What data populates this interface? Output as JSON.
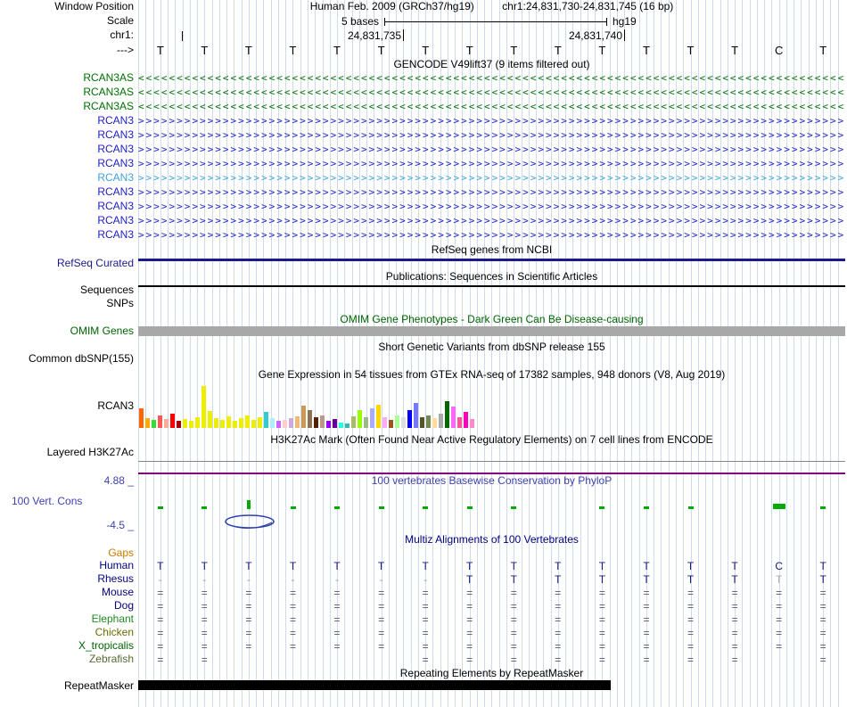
{
  "header": {
    "window_position_label": "Window Position",
    "assembly_text": "Human Feb. 2009 (GRCh37/hg19)",
    "position_text": "chr1:24,831,730-24,831,745 (16 bp)",
    "scale_label": "Scale",
    "scale_text": "5 bases",
    "assembly_short": "hg19",
    "chrom_label": "chr1:",
    "ruler_labels": [
      "24,831,735",
      "24,831,740"
    ],
    "strand_arrow": "--->"
  },
  "bases": [
    "T",
    "T",
    "T",
    "T",
    "T",
    "T",
    "T",
    "T",
    "T",
    "T",
    "T",
    "T",
    "T",
    "T",
    "C",
    "T"
  ],
  "gencode": {
    "title": "GENCODE V49lift37 (9 items filtered out)",
    "genes": [
      {
        "name": "RCAN3AS",
        "strand": "<",
        "color": "#007200"
      },
      {
        "name": "RCAN3AS",
        "strand": "<",
        "color": "#007200"
      },
      {
        "name": "RCAN3AS",
        "strand": "<",
        "color": "#007200"
      },
      {
        "name": "RCAN3",
        "strand": ">",
        "color": "#2020c8"
      },
      {
        "name": "RCAN3",
        "strand": ">",
        "color": "#2020c8"
      },
      {
        "name": "RCAN3",
        "strand": ">",
        "color": "#2020c8"
      },
      {
        "name": "RCAN3",
        "strand": ">",
        "color": "#2020c8"
      },
      {
        "name": "RCAN3",
        "strand": ">",
        "color": "#3fa2dc"
      },
      {
        "name": "RCAN3",
        "strand": ">",
        "color": "#2020c8"
      },
      {
        "name": "RCAN3",
        "strand": ">",
        "color": "#2020c8"
      },
      {
        "name": "RCAN3",
        "strand": ">",
        "color": "#2020c8"
      },
      {
        "name": "RCAN3",
        "strand": ">",
        "color": "#2020c8"
      }
    ]
  },
  "refseq": {
    "title": "RefSeq genes from NCBI",
    "label": "RefSeq Curated",
    "color": "#1a1a8c"
  },
  "publications": {
    "title": "Publications: Sequences in Scientific Articles",
    "label": "Sequences"
  },
  "snps": {
    "label": "SNPs"
  },
  "omim": {
    "title": "OMIM Gene Phenotypes - Dark Green Can Be Disease-causing",
    "label": "OMIM Genes",
    "text_color": "#006400",
    "bar_color": "#a8a8a8"
  },
  "dbsnp": {
    "title": "Short Genetic Variants from dbSNP release 155",
    "label": "Common dbSNP(155)"
  },
  "gtex": {
    "label": "RCAN3"
  },
  "h3k27ac": {
    "title": "H3K27Ac Mark (Often Found Near Active Regulatory Elements) on 7 cell lines from ENCODE",
    "label": "Layered H3K27Ac",
    "line_color": "#800080"
  },
  "conservation": {
    "title": "100 vertebrates Basewise Conservation by PhyloP",
    "label": "100 Vert. Cons",
    "scale_max": "4.88 _",
    "scale_min": "-4.5 _",
    "text_color": "#4040b0",
    "tick_color": "#00aa00",
    "ticks": [
      {
        "col": 0,
        "h": 3,
        "w": 6
      },
      {
        "col": 1,
        "h": 3,
        "w": 6
      },
      {
        "col": 2,
        "h": 10,
        "w": 4
      },
      {
        "col": 3,
        "h": 3,
        "w": 6
      },
      {
        "col": 4,
        "h": 3,
        "w": 6
      },
      {
        "col": 5,
        "h": 3,
        "w": 6
      },
      {
        "col": 6,
        "h": 3,
        "w": 6
      },
      {
        "col": 7,
        "h": 3,
        "w": 6
      },
      {
        "col": 8,
        "h": 3,
        "w": 6
      },
      {
        "col": 10,
        "h": 3,
        "w": 6
      },
      {
        "col": 11,
        "h": 3,
        "w": 6
      },
      {
        "col": 12,
        "h": 3,
        "w": 6
      },
      {
        "col": 14,
        "h": 6,
        "w": 14
      },
      {
        "col": 15,
        "h": 3,
        "w": 6
      }
    ]
  },
  "multiz": {
    "title": "Multiz Alignments of 100 Vertebrates",
    "gaps_label": "Gaps",
    "gaps_color": "#cc7a00",
    "rows": [
      {
        "name": "Human",
        "color": "#000080",
        "cells": [
          "T",
          "T",
          "T",
          "T",
          "T",
          "T",
          "T",
          "T",
          "T",
          "T",
          "T",
          "T",
          "T",
          "T",
          "C",
          "T"
        ]
      },
      {
        "name": "Rhesus",
        "color": "#000080",
        "muted_cols": [
          14
        ],
        "cells": [
          "-",
          "-",
          "-",
          "-",
          "-",
          "-",
          "-",
          "T",
          "T",
          "T",
          "T",
          "T",
          "T",
          "T",
          "T",
          "T"
        ]
      },
      {
        "name": "Mouse",
        "color": "#000080",
        "cells": [
          "=",
          "=",
          "=",
          "=",
          "=",
          "=",
          "=",
          "=",
          "=",
          "=",
          "=",
          "=",
          "=",
          "=",
          "=",
          "="
        ]
      },
      {
        "name": "Dog",
        "color": "#000080",
        "cells": [
          "=",
          "=",
          "=",
          "=",
          "=",
          "=",
          "=",
          "=",
          "=",
          "=",
          "=",
          "=",
          "=",
          "=",
          "=",
          "="
        ]
      },
      {
        "name": "Elephant",
        "color": "#1f8a1f",
        "cells": [
          "=",
          "=",
          "=",
          "=",
          "=",
          "=",
          "=",
          "=",
          "=",
          "=",
          "=",
          "=",
          "=",
          "=",
          "=",
          "="
        ]
      },
      {
        "name": "Chicken",
        "color": "#6b6b00",
        "cells": [
          "=",
          "=",
          "=",
          "=",
          "=",
          "=",
          "=",
          "=",
          "=",
          "=",
          "=",
          "=",
          "=",
          "=",
          "=",
          "="
        ]
      },
      {
        "name": "X_tropicalis",
        "color": "#006400",
        "cells": [
          "=",
          "=",
          "=",
          "=",
          "=",
          "=",
          "=",
          "=",
          "=",
          "=",
          "=",
          "=",
          "=",
          "=",
          "=",
          "="
        ]
      },
      {
        "name": "Zebrafish",
        "color": "#556b2f",
        "cells": [
          "=",
          "=",
          "",
          "",
          "",
          "",
          "=",
          "=",
          "=",
          "=",
          "=",
          "=",
          "=",
          "=",
          "",
          "="
        ]
      }
    ],
    "cell_colors": {
      "letter": "#15157a",
      "gap": "#555577",
      "dash": "#999999",
      "muted": "#aaaaaa"
    }
  },
  "repeatmasker": {
    "title": "Repeating Elements by RepeatMasker",
    "label": "RepeatMasker"
  },
  "chart_data": {
    "type": "bar",
    "title": "Gene Expression in 54 tissues from GTEx RNA-seq of 17382 samples, 948 donors (V8, Aug 2019)",
    "gene": "RCAN3",
    "n_bars": 54,
    "note": "heights are pixel estimates from screenshot; tissue names not rendered in image",
    "bars": [
      {
        "h": 22,
        "c": "#ff6600"
      },
      {
        "h": 11,
        "c": "#ffaa00"
      },
      {
        "h": 9,
        "c": "#33dd33"
      },
      {
        "h": 14,
        "c": "#ff5555"
      },
      {
        "h": 10,
        "c": "#ffaa99"
      },
      {
        "h": 16,
        "c": "#ff0000"
      },
      {
        "h": 8,
        "c": "#aa0000"
      },
      {
        "h": 10,
        "c": "#eeee00"
      },
      {
        "h": 8,
        "c": "#eeee00"
      },
      {
        "h": 12,
        "c": "#eeee00"
      },
      {
        "h": 47,
        "c": "#eeee00"
      },
      {
        "h": 19,
        "c": "#eeee00"
      },
      {
        "h": 11,
        "c": "#eeee00"
      },
      {
        "h": 9,
        "c": "#eeee00"
      },
      {
        "h": 13,
        "c": "#eeee00"
      },
      {
        "h": 8,
        "c": "#eeee00"
      },
      {
        "h": 11,
        "c": "#eeee00"
      },
      {
        "h": 14,
        "c": "#eeee00"
      },
      {
        "h": 9,
        "c": "#eeee00"
      },
      {
        "h": 12,
        "c": "#eeee00"
      },
      {
        "h": 18,
        "c": "#33cccc"
      },
      {
        "h": 11,
        "c": "#aaeeff"
      },
      {
        "h": 8,
        "c": "#cc66ff"
      },
      {
        "h": 9,
        "c": "#ffcccc"
      },
      {
        "h": 11,
        "c": "#ccaadd"
      },
      {
        "h": 13,
        "c": "#eebb77"
      },
      {
        "h": 25,
        "c": "#cc9955"
      },
      {
        "h": 20,
        "c": "#8b7355"
      },
      {
        "h": 12,
        "c": "#552200"
      },
      {
        "h": 14,
        "c": "#bb9988"
      },
      {
        "h": 8,
        "c": "#9900ff"
      },
      {
        "h": 10,
        "c": "#660099"
      },
      {
        "h": 6,
        "c": "#22ffdd"
      },
      {
        "h": 5,
        "c": "#33bbaa"
      },
      {
        "h": 13,
        "c": "#aabb66"
      },
      {
        "h": 20,
        "c": "#99ff00"
      },
      {
        "h": 12,
        "c": "#99bb88"
      },
      {
        "h": 22,
        "c": "#aaaaff"
      },
      {
        "h": 26,
        "c": "#ffd700"
      },
      {
        "h": 12,
        "c": "#ffaaff"
      },
      {
        "h": 9,
        "c": "#995522"
      },
      {
        "h": 14,
        "c": "#aaff99"
      },
      {
        "h": 12,
        "c": "#dddddd"
      },
      {
        "h": 20,
        "c": "#0000ff"
      },
      {
        "h": 28,
        "c": "#7777ff"
      },
      {
        "h": 12,
        "c": "#555522"
      },
      {
        "h": 14,
        "c": "#778855"
      },
      {
        "h": 11,
        "c": "#ffdd99"
      },
      {
        "h": 16,
        "c": "#aaaaaa"
      },
      {
        "h": 30,
        "c": "#006600"
      },
      {
        "h": 24,
        "c": "#ff66ff"
      },
      {
        "h": 12,
        "c": "#ff5599"
      },
      {
        "h": 18,
        "c": "#ff00bb"
      },
      {
        "h": 10,
        "c": "#ff88cc"
      }
    ]
  }
}
